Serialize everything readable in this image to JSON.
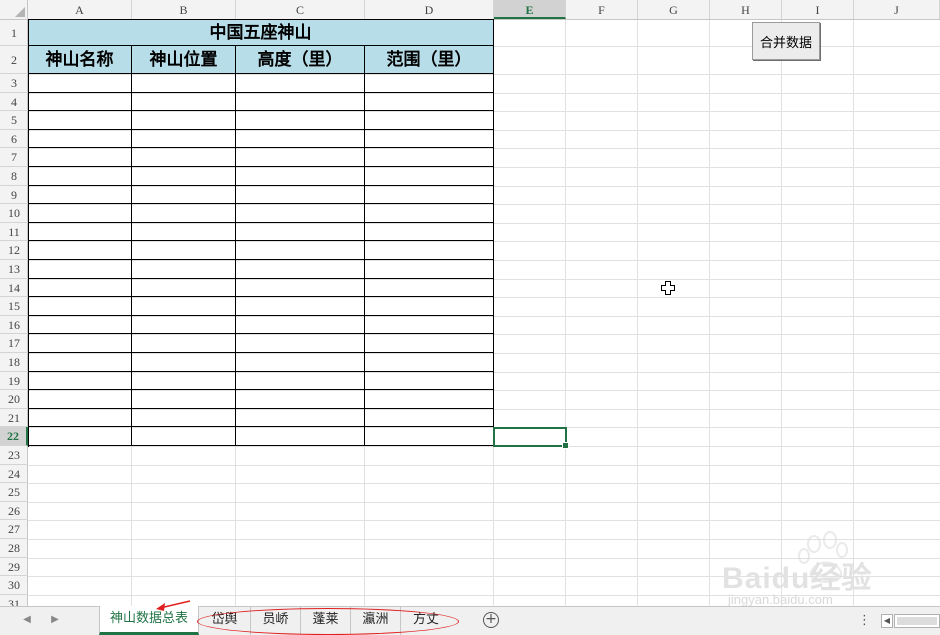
{
  "spreadsheet": {
    "columns": [
      "A",
      "B",
      "C",
      "D",
      "E",
      "F",
      "G",
      "H",
      "I",
      "J"
    ],
    "selected_column": "E",
    "rows": [
      "1",
      "2",
      "3",
      "4",
      "5",
      "6",
      "7",
      "8",
      "9",
      "10",
      "11",
      "12",
      "13",
      "14",
      "15",
      "16",
      "17",
      "18",
      "19",
      "20",
      "21",
      "22",
      "23",
      "24",
      "25",
      "26",
      "27",
      "28",
      "29",
      "30",
      "31"
    ],
    "selected_row": "22",
    "table": {
      "title": "中国五座神山",
      "headers": [
        "神山名称",
        "神山位置",
        "高度（里）",
        "范围（里）"
      ]
    },
    "macro_button_label": "合并数据",
    "header_fill_color": "#b7dde8",
    "accent_color": "#217346"
  },
  "sheet_tabs": {
    "tabs": [
      "神山数据总表",
      "岱舆",
      "员峤",
      "蓬莱",
      "瀛洲",
      "方丈"
    ],
    "active_tab": "神山数据总表",
    "annotation_color": "#e02020"
  },
  "watermark": {
    "brand": "Baidu经验",
    "url": "jingyan.baidu.com"
  }
}
